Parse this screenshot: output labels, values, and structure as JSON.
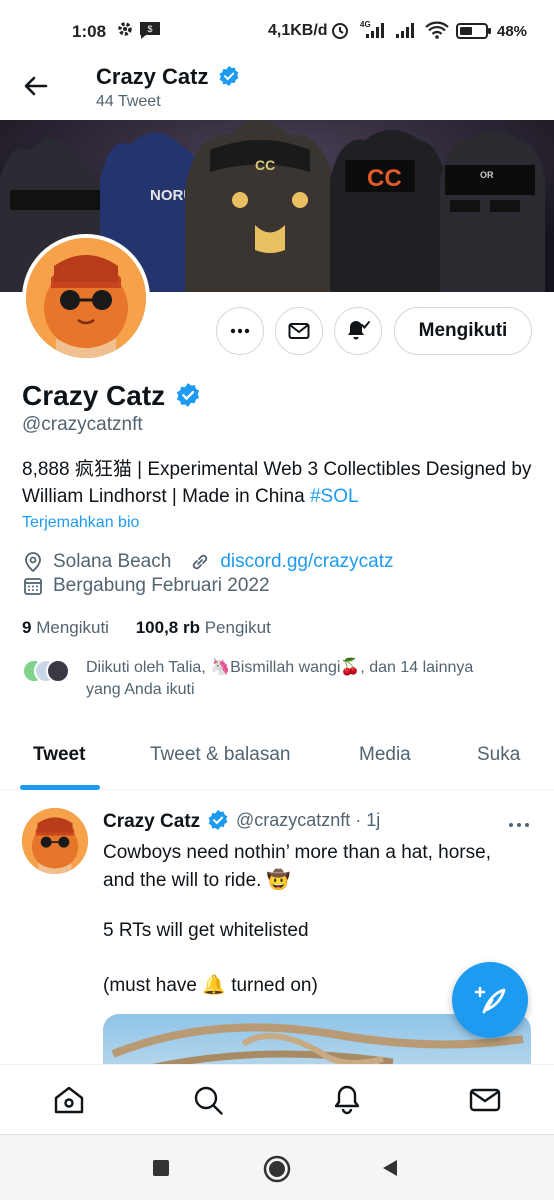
{
  "status_bar": {
    "time": "1:08",
    "network_speed": "4,1KB/d",
    "network_type": "4G",
    "battery": "48%"
  },
  "header": {
    "title": "Crazy Catz",
    "subtitle": "44 Tweet"
  },
  "actions": {
    "follow_label": "Mengikuti"
  },
  "profile": {
    "name": "Crazy Catz",
    "handle": "@crazycatznft",
    "bio_text": "8,888 疯狂猫 | Experimental Web 3 Collectibles Designed by William Lindhorst | Made in China ",
    "bio_hashtag": "#SOL",
    "translate_label": "Terjemahkan bio",
    "location": "Solana Beach",
    "website": "discord.gg/crazycatz",
    "joined": "Bergabung Februari 2022",
    "following_count": "9",
    "following_label": "Mengikuti",
    "followers_count": "100,8 rb",
    "followers_label": "Pengikut",
    "followed_by_line1": "Diikuti oleh Talia, 🦄Bismillah wangi🍒, dan 14 lainnya",
    "followed_by_line2": "yang Anda ikuti"
  },
  "tabs": [
    {
      "label": "Tweet",
      "active": true
    },
    {
      "label": "Tweet & balasan",
      "active": false
    },
    {
      "label": "Media",
      "active": false
    },
    {
      "label": "Suka",
      "active": false
    }
  ],
  "tweet": {
    "author": "Crazy Catz",
    "handle_time": "@crazycatznft · 1j",
    "lines": [
      "Cowboys need nothin’ more than a hat, horse,",
      "and the will to ride. 🤠",
      "5 RTs will get whitelisted",
      "(must have 🔔 turned on)"
    ]
  },
  "colors": {
    "accent": "#1d9bf0",
    "text_primary": "#0f1419",
    "text_secondary": "#536471",
    "avatar_orange": "#f08a2a"
  }
}
